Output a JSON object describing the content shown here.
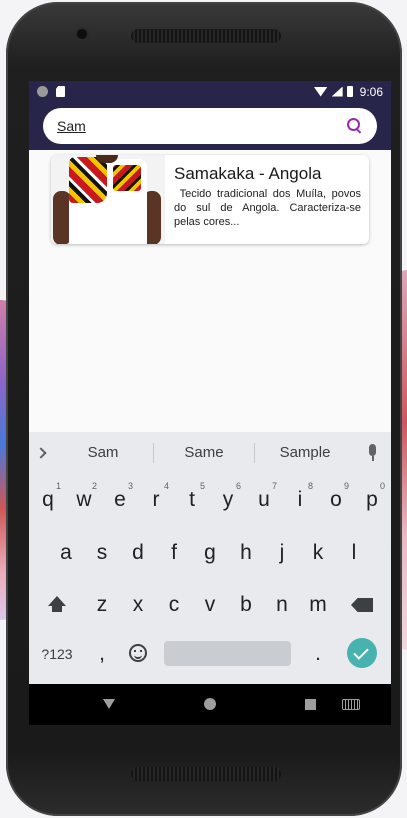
{
  "status_bar": {
    "time": "9:06"
  },
  "search": {
    "value": "Sam",
    "placeholder": ""
  },
  "results": [
    {
      "title": "Samakaka - Angola",
      "description": " Tecido tradicional dos Muíla, povos do sul de Angola. Caracteriza-se pelas cores..."
    }
  ],
  "keyboard": {
    "suggestions": [
      "Sam",
      "Same",
      "Sample"
    ],
    "row1": [
      {
        "k": "q",
        "n": "1"
      },
      {
        "k": "w",
        "n": "2"
      },
      {
        "k": "e",
        "n": "3"
      },
      {
        "k": "r",
        "n": "4"
      },
      {
        "k": "t",
        "n": "5"
      },
      {
        "k": "y",
        "n": "6"
      },
      {
        "k": "u",
        "n": "7"
      },
      {
        "k": "i",
        "n": "8"
      },
      {
        "k": "o",
        "n": "9"
      },
      {
        "k": "p",
        "n": "0"
      }
    ],
    "row2": [
      "a",
      "s",
      "d",
      "f",
      "g",
      "h",
      "j",
      "k",
      "l"
    ],
    "row3": [
      "z",
      "x",
      "c",
      "v",
      "b",
      "n",
      "m"
    ],
    "symbols_label": "?123",
    "comma": ",",
    "period": "."
  },
  "colors": {
    "app_bar": "#27264a",
    "accent": "#9b27b0",
    "enter_key": "#46b3ae"
  },
  "icons": [
    "sd-card-icon",
    "wifi-icon",
    "cell-signal-icon",
    "battery-icon",
    "search-icon",
    "chevron-right-icon",
    "mic-icon",
    "shift-icon",
    "backspace-icon",
    "emoji-icon",
    "enter-check-icon",
    "nav-back-icon",
    "nav-home-icon",
    "nav-recents-icon",
    "keyboard-icon"
  ]
}
